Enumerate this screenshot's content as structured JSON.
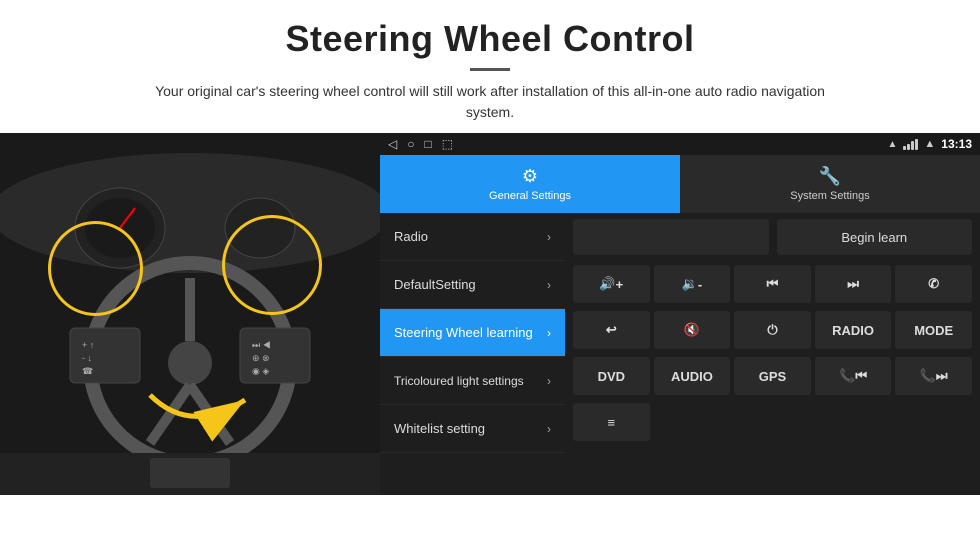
{
  "header": {
    "title": "Steering Wheel Control",
    "divider": true,
    "subtitle": "Your original car's steering wheel control will still work after installation of this all-in-one auto radio navigation system."
  },
  "status_bar": {
    "time": "13:13",
    "back_icon": "◁",
    "home_icon": "○",
    "recent_icon": "□",
    "screenshot_icon": "⬚"
  },
  "tabs": [
    {
      "id": "general",
      "label": "General Settings",
      "active": true
    },
    {
      "id": "system",
      "label": "System Settings",
      "active": false
    }
  ],
  "menu": {
    "items": [
      {
        "id": "radio",
        "label": "Radio",
        "active": false
      },
      {
        "id": "default",
        "label": "DefaultSetting",
        "active": false
      },
      {
        "id": "steering",
        "label": "Steering Wheel learning",
        "active": true
      },
      {
        "id": "tricoloured",
        "label": "Tricoloured light settings",
        "active": false
      },
      {
        "id": "whitelist",
        "label": "Whitelist setting",
        "active": false
      }
    ]
  },
  "controls": {
    "begin_learn_label": "Begin learn",
    "buttons_row1": [
      {
        "id": "vol_up",
        "label": "🔊+"
      },
      {
        "id": "vol_down",
        "label": "🔉-"
      },
      {
        "id": "prev",
        "label": "⏮"
      },
      {
        "id": "next",
        "label": "⏭"
      },
      {
        "id": "phone",
        "label": "✆"
      }
    ],
    "buttons_row2": [
      {
        "id": "hang_up",
        "label": "↩"
      },
      {
        "id": "mute",
        "label": "🔇×"
      },
      {
        "id": "power",
        "label": "⏻"
      },
      {
        "id": "radio_btn",
        "label": "RADIO"
      },
      {
        "id": "mode",
        "label": "MODE"
      }
    ],
    "buttons_row3": [
      {
        "id": "dvd",
        "label": "DVD"
      },
      {
        "id": "audio",
        "label": "AUDIO"
      },
      {
        "id": "gps",
        "label": "GPS"
      },
      {
        "id": "tel_prev",
        "label": "📞⏮"
      },
      {
        "id": "tel_next",
        "label": "📞⏭"
      }
    ],
    "buttons_row4": [
      {
        "id": "menu_icon",
        "label": "≡"
      }
    ]
  }
}
